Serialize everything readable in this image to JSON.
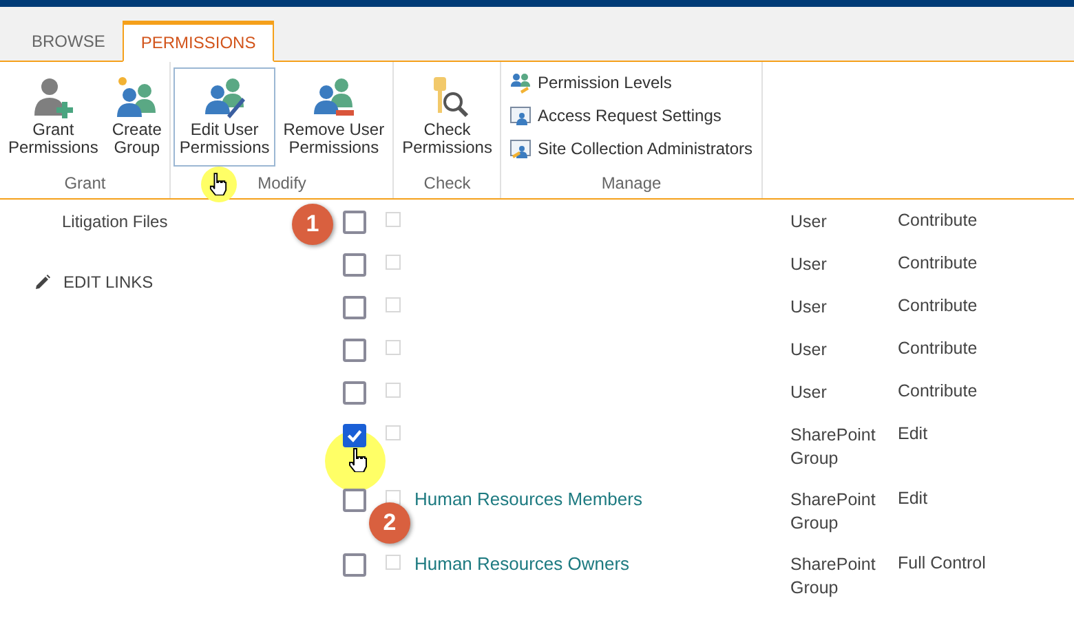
{
  "tabs": [
    {
      "label": "BROWSE",
      "selected": false
    },
    {
      "label": "PERMISSIONS",
      "selected": true
    }
  ],
  "ribbon": {
    "groups": [
      {
        "label": "Grant",
        "buttons": [
          {
            "kind": "large",
            "label": [
              "Grant",
              "Permissions"
            ],
            "highlighted": false
          },
          {
            "kind": "large",
            "label": [
              "Create",
              "Group"
            ],
            "highlighted": false
          }
        ]
      },
      {
        "label": "Modify",
        "buttons": [
          {
            "kind": "large",
            "label": [
              "Edit User",
              "Permissions"
            ],
            "highlighted": true
          },
          {
            "kind": "large",
            "label": [
              "Remove User",
              "Permissions"
            ],
            "highlighted": false
          }
        ]
      },
      {
        "label": "Check",
        "buttons": [
          {
            "kind": "large",
            "label": [
              "Check",
              "Permissions"
            ],
            "highlighted": false
          }
        ]
      },
      {
        "label": "Manage",
        "buttons": [
          {
            "kind": "small",
            "label": [
              "Permission Levels"
            ],
            "highlighted": false
          },
          {
            "kind": "small",
            "label": [
              "Access Request Settings"
            ],
            "highlighted": false
          },
          {
            "kind": "small",
            "label": [
              "Site Collection Administrators"
            ],
            "highlighted": false
          }
        ]
      }
    ]
  },
  "nav": {
    "items": [
      "Litigation Files"
    ],
    "edit_links": "EDIT LINKS"
  },
  "rows": [
    {
      "checked": false,
      "second_checked": false,
      "name": "",
      "type": "User",
      "permission": "Contribute"
    },
    {
      "checked": false,
      "second_checked": false,
      "name": "",
      "type": "User",
      "permission": "Contribute"
    },
    {
      "checked": false,
      "second_checked": false,
      "name": "",
      "type": "User",
      "permission": "Contribute"
    },
    {
      "checked": false,
      "second_checked": false,
      "name": "",
      "type": "User",
      "permission": "Contribute"
    },
    {
      "checked": false,
      "second_checked": false,
      "name": "",
      "type": "User",
      "permission": "Contribute"
    },
    {
      "checked": true,
      "second_checked": false,
      "name": "",
      "type": "SharePoint Group",
      "permission": "Edit"
    },
    {
      "checked": false,
      "second_checked": false,
      "name": "Human Resources Members",
      "type": "SharePoint Group",
      "permission": "Edit"
    },
    {
      "checked": false,
      "second_checked": false,
      "name": "Human Resources Owners",
      "type": "SharePoint Group",
      "permission": "Full Control"
    }
  ],
  "callouts": [
    "1",
    "2"
  ]
}
